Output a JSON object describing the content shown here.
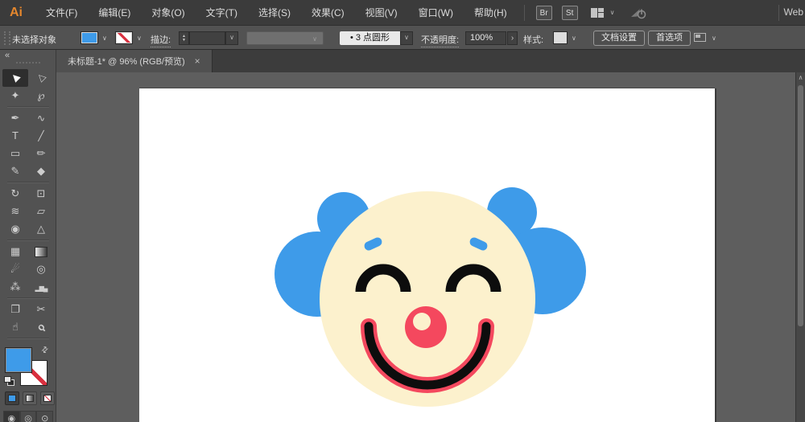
{
  "app": {
    "logo_text": "Ai",
    "workspace_label": "Web"
  },
  "menubar": {
    "items": [
      "文件(F)",
      "编辑(E)",
      "对象(O)",
      "文字(T)",
      "选择(S)",
      "效果(C)",
      "视图(V)",
      "窗口(W)",
      "帮助(H)"
    ],
    "bridge": "Br",
    "stock": "St"
  },
  "controlbar": {
    "status": "未选择对象",
    "fill_color": "#3E9BE9",
    "stroke_label": "描边:",
    "stroke_value": "",
    "brush_preview": "•",
    "brush_name": "3 点圆形",
    "opacity_label": "不透明度:",
    "opacity_value": "100%",
    "style_label": "样式:",
    "doc_setup": "文档设置",
    "preferences": "首选项"
  },
  "tab": {
    "title": "未标题-1* @ 96% (RGB/预览)",
    "close_glyph": "×"
  },
  "toolbar": {
    "collapse_glyph": "«",
    "fill_color": "#3E9BE9",
    "tools": [
      {
        "name": "selection",
        "glyph": "▶",
        "active": true
      },
      {
        "name": "direct-selection",
        "glyph": "▷"
      },
      {
        "name": "magic-wand",
        "glyph": "✦"
      },
      {
        "name": "lasso",
        "glyph": "℘"
      },
      {
        "name": "pen",
        "glyph": "✒"
      },
      {
        "name": "curvature",
        "glyph": "∿"
      },
      {
        "name": "type",
        "glyph": "T"
      },
      {
        "name": "line-segment",
        "glyph": "╱"
      },
      {
        "name": "rectangle",
        "glyph": "▭"
      },
      {
        "name": "paintbrush",
        "glyph": "✏"
      },
      {
        "name": "pencil",
        "glyph": "✎"
      },
      {
        "name": "eraser",
        "glyph": "◆"
      },
      {
        "name": "rotate",
        "glyph": "↻"
      },
      {
        "name": "scale",
        "glyph": "⊡"
      },
      {
        "name": "width",
        "glyph": "≋"
      },
      {
        "name": "free-transform",
        "glyph": "▱"
      },
      {
        "name": "shape-builder",
        "glyph": "◉"
      },
      {
        "name": "perspective-grid",
        "glyph": "△"
      },
      {
        "name": "mesh",
        "glyph": "▦"
      },
      {
        "name": "gradient",
        "glyph": ""
      },
      {
        "name": "eyedropper",
        "glyph": "☄"
      },
      {
        "name": "blend",
        "glyph": "◎"
      },
      {
        "name": "symbol-sprayer",
        "glyph": "⁂"
      },
      {
        "name": "column-graph",
        "glyph": "▂▆▄"
      },
      {
        "name": "artboard",
        "glyph": "❐"
      },
      {
        "name": "slice",
        "glyph": "✂"
      },
      {
        "name": "hand",
        "glyph": "☝"
      },
      {
        "name": "zoom",
        "glyph": "ϙ"
      }
    ],
    "drawing_modes": [
      "◉",
      "◎",
      "⊙"
    ]
  },
  "glyphs": {
    "chevron": "∨",
    "popup_arrow": "›",
    "stepper_up": "▲",
    "stepper_down": "▼",
    "swap": "⇄",
    "scroll_up": "∧"
  },
  "canvas": {
    "clown": {
      "colors": {
        "hair_blue": "#3E9BE9",
        "face_cream": "#FCF1CD",
        "nose_red": "#F4485E",
        "line_black": "#0D0D0D"
      }
    }
  }
}
